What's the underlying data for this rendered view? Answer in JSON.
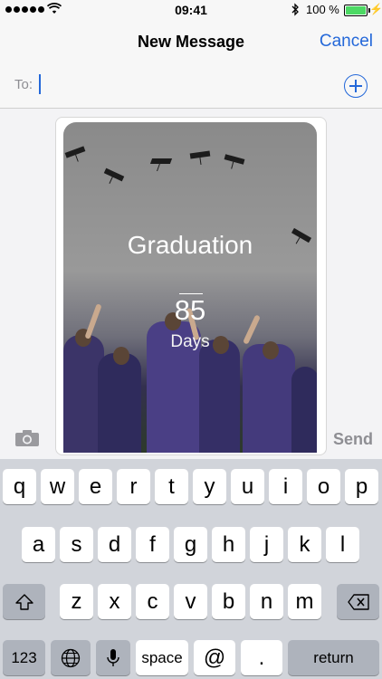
{
  "status": {
    "time": "09:41",
    "battery": "100 %"
  },
  "nav": {
    "title": "New Message",
    "cancel": "Cancel"
  },
  "to": {
    "label": "To:"
  },
  "card": {
    "title": "Graduation",
    "count": "85",
    "unit": "Days"
  },
  "compose": {
    "send": "Send"
  },
  "keyboard": {
    "row1": [
      "q",
      "w",
      "e",
      "r",
      "t",
      "y",
      "u",
      "i",
      "o",
      "p"
    ],
    "row2": [
      "a",
      "s",
      "d",
      "f",
      "g",
      "h",
      "j",
      "k",
      "l"
    ],
    "row3": [
      "z",
      "x",
      "c",
      "v",
      "b",
      "n",
      "m"
    ],
    "numbers": "123",
    "space": "space",
    "at": "@",
    "dot": ".",
    "return": "return"
  }
}
